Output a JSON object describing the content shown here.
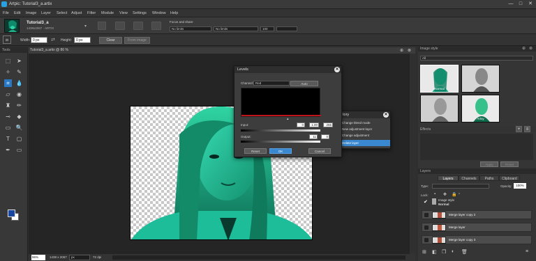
{
  "window": {
    "title": "Artpic: Tutorial3_a.artix",
    "minimize": "—",
    "maximize": "□",
    "close": "✕"
  },
  "menu": [
    "File",
    "Edit",
    "Image",
    "Layer",
    "Select",
    "Adjust",
    "Filter",
    "Module",
    "View",
    "Settings",
    "Window",
    "Help"
  ],
  "topbar": {
    "doc_name": "Tutorial3_a",
    "doc_size": "1438x2067 · ARTIX",
    "zoom_title": "Focus and share",
    "dropdown1": "No limits",
    "dropdown2": "No limits",
    "dropdown3": "100"
  },
  "options": {
    "width_label": "Width:",
    "width_value": "0 px",
    "height_label": "Height:",
    "height_value": "0 px",
    "clear": "Clear",
    "from_image": "From image"
  },
  "tools_panel": {
    "title": "Tools"
  },
  "document": {
    "tab_title": "Tutorial3_a.artix @ 86 %",
    "zoom": "86%",
    "dimensions": "1438 x 2067",
    "unit": "px",
    "resolution": "72 dpi"
  },
  "levels": {
    "title": "Levels",
    "channel_label": "Channel:",
    "channel_value": "Red",
    "auto": "Auto",
    "input_label": "Input:",
    "input_values": [
      "0",
      "1.00",
      "255"
    ],
    "output_label": "Output:",
    "output_values": [
      "11",
      "0"
    ],
    "reset": "Reset",
    "ok": "OK",
    "cancel": "Cancel"
  },
  "history": {
    "title": "tory",
    "items": [
      "Change blend mode",
      "New adjustment layer",
      "Change adjustment",
      "Delete layer"
    ],
    "selected": 3
  },
  "image_style": {
    "title": "Image style",
    "dropdown": "All",
    "styles": [
      "Normal",
      "",
      "",
      "Artsy"
    ]
  },
  "effects": {
    "title": "Effects",
    "add": "+",
    "apply": "Apply",
    "reset": "Reset"
  },
  "layers": {
    "title": "Layers",
    "tabs": [
      "Layers",
      "Channels",
      "Paths",
      "Clipboard"
    ],
    "active_tab": 0,
    "type_label": "Type:",
    "opacity_label": "Opacity:",
    "opacity_value": "100%",
    "lock_label": "Lock:",
    "style_group": "Image style",
    "style_mode": "Normal",
    "items": [
      "Merge layer copy 2",
      "Merge layer",
      "Merge layer copy 3"
    ]
  },
  "colors": {
    "accent": "#3a88d0",
    "teal": "#1fb38e"
  }
}
